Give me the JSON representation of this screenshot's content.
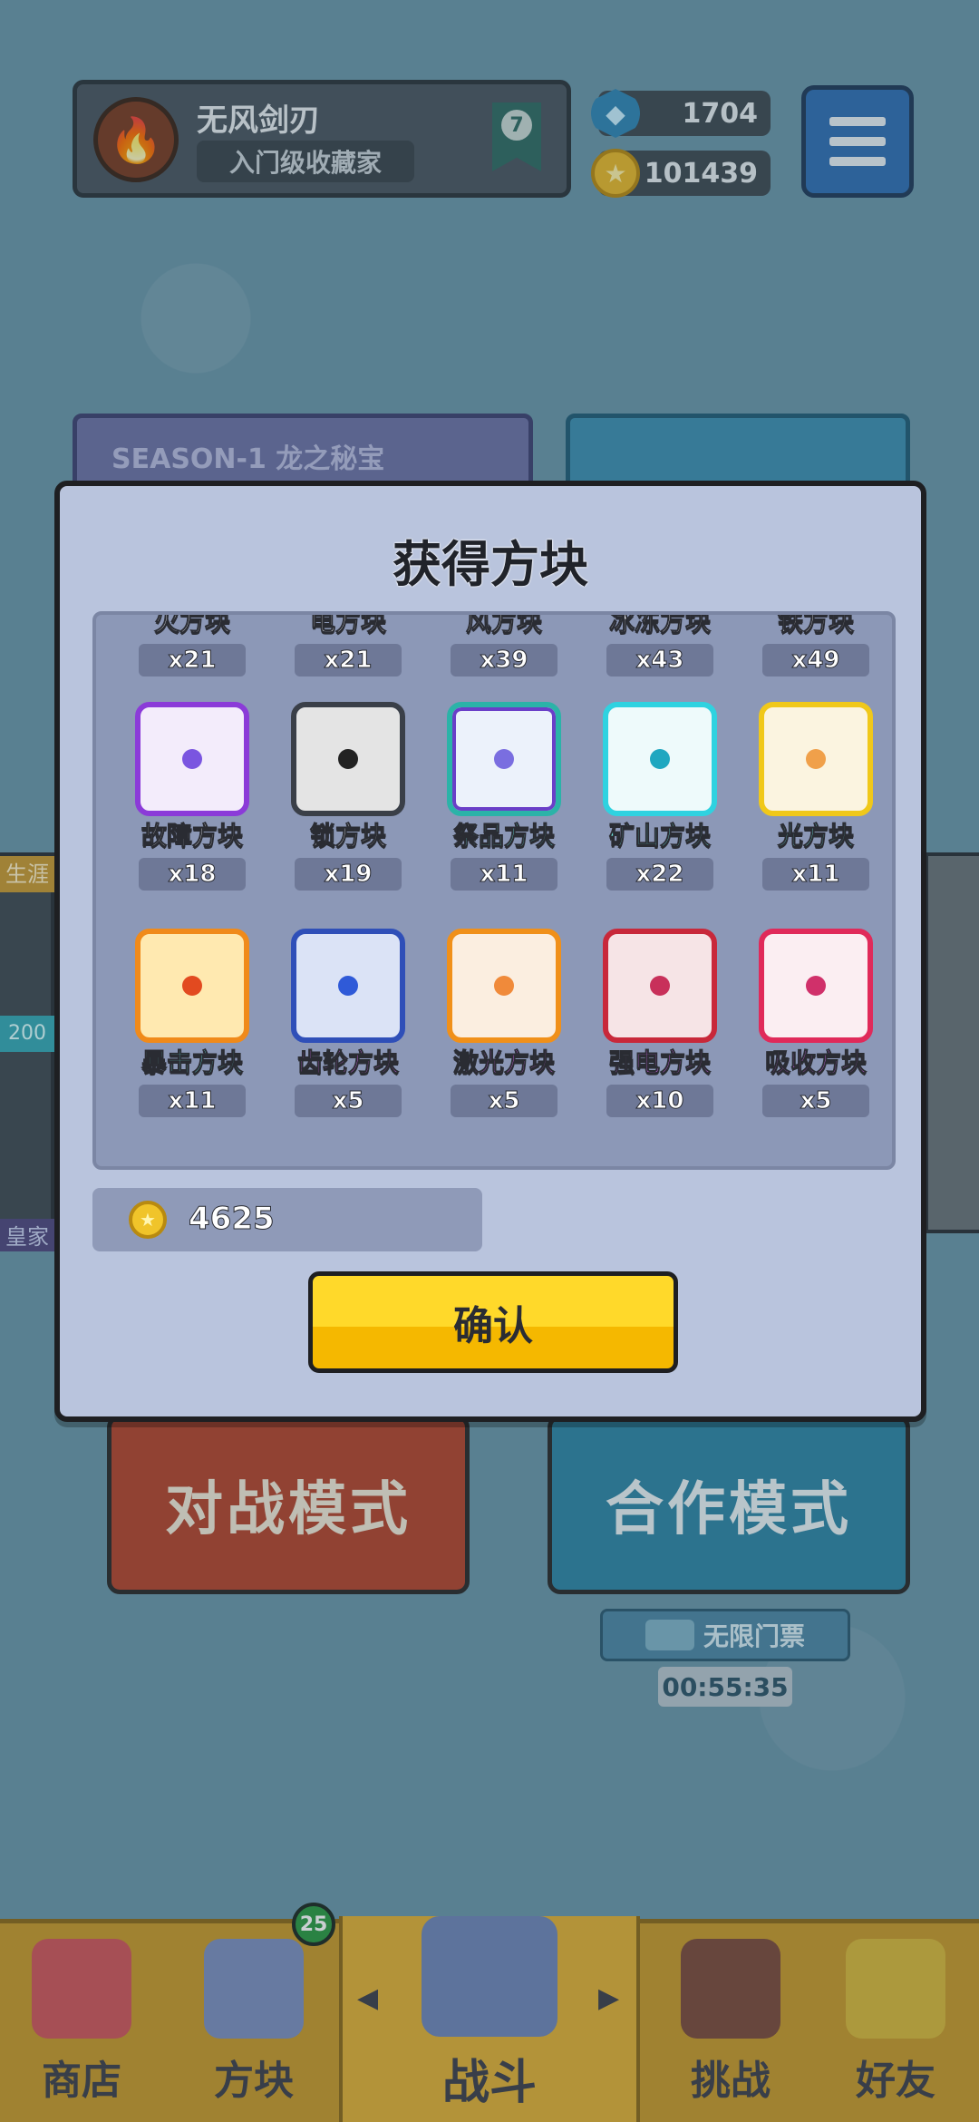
{
  "player": {
    "name": "无风剑刃",
    "title": "入门级收藏家",
    "rank": "7"
  },
  "currencies": {
    "gems": "1704",
    "gold": "101439"
  },
  "background": {
    "season_label": "SEASON-1 龙之秘宝",
    "battle_mode": "对战模式",
    "coop_mode": "合作模式",
    "ticket_label": "无限门票",
    "timer": "00:55:35",
    "left_tag": "生涯",
    "left_number": "200",
    "left_royal": "皇家"
  },
  "dialog": {
    "title": "获得方块",
    "partial_row": [
      {
        "label": "火方块",
        "count": "x21"
      },
      {
        "label": "电方块",
        "count": "x21"
      },
      {
        "label": "风方块",
        "count": "x39"
      },
      {
        "label": "冰冻方块",
        "count": "x43"
      },
      {
        "label": "铁方块",
        "count": "x49"
      }
    ],
    "row2": [
      {
        "label": "故障方块",
        "count": "x18"
      },
      {
        "label": "锁方块",
        "count": "x19"
      },
      {
        "label": "祭品方块",
        "count": "x11"
      },
      {
        "label": "矿山方块",
        "count": "x22"
      },
      {
        "label": "光方块",
        "count": "x11"
      }
    ],
    "row3": [
      {
        "label": "暴击方块",
        "count": "x11"
      },
      {
        "label": "齿轮方块",
        "count": "x5"
      },
      {
        "label": "激光方块",
        "count": "x5"
      },
      {
        "label": "强电方块",
        "count": "x10"
      },
      {
        "label": "吸收方块",
        "count": "x5"
      }
    ],
    "gold_reward": "4625",
    "confirm_label": "确认"
  },
  "nav": {
    "shop": "商店",
    "dice": "方块",
    "battle": "战斗",
    "challenge": "挑战",
    "friends": "好友",
    "dice_badge": "25"
  },
  "icons": {
    "avatar": "fire-icon",
    "gem": "gem-icon",
    "coin": "coin-icon",
    "menu": "hamburger-menu-icon"
  },
  "colors": {
    "dialog_bg": "#b9c4dd",
    "confirm_yellow": "#ffd92a",
    "battle_red": "#b4452d",
    "coop_blue": "#2e86a6"
  }
}
